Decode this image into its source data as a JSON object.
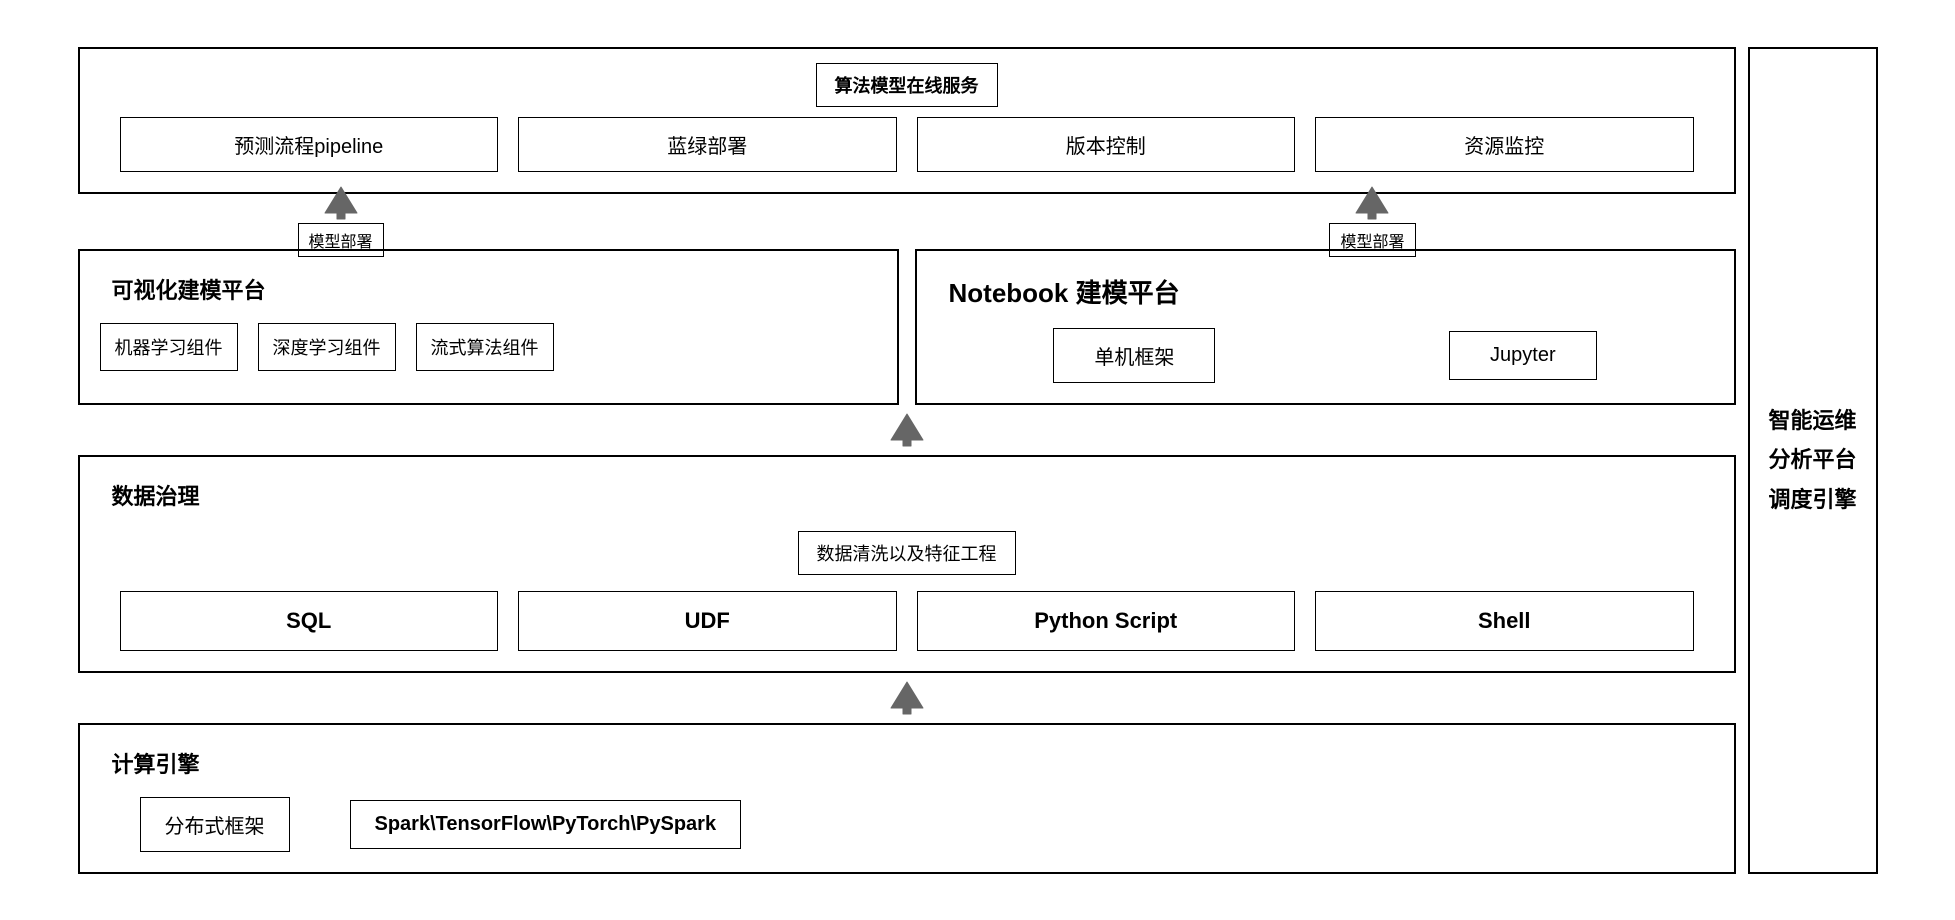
{
  "algo": {
    "title": "算法模型在线服务",
    "items": [
      "预测流程pipeline",
      "蓝绿部署",
      "版本控制",
      "资源监控"
    ]
  },
  "arrows_top": {
    "left_label": "模型部署",
    "right_label": "模型部署"
  },
  "visual": {
    "title": "可视化建模平台",
    "items": [
      "机器学习组件",
      "深度学习组件",
      "流式算法组件"
    ]
  },
  "notebook": {
    "title": "Notebook 建模平台",
    "items": [
      "单机框架",
      "Jupyter"
    ]
  },
  "arrow_middle_label": "",
  "data": {
    "title": "数据治理",
    "sublabel": "数据清洗以及特征工程",
    "items": [
      "SQL",
      "UDF",
      "Python Script",
      "Shell"
    ]
  },
  "compute": {
    "title": "计算引擎",
    "items": [
      "分布式框架",
      "Spark\\TensorFlow\\PyTorch\\PySpark"
    ]
  },
  "sidebar": {
    "label": "智能运维分析平台调度引擎"
  }
}
